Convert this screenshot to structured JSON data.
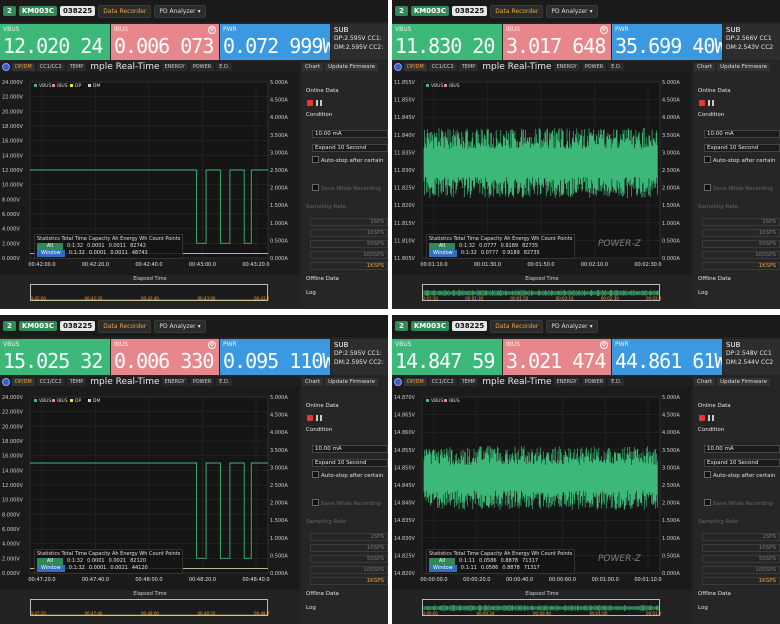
{
  "app": {
    "device_number": "2",
    "device_model": "KM003C",
    "device_serial": "038225",
    "data_recorder_label": "Data Recorder",
    "pd_analyzer_label": "PD Analyzer",
    "dropdown_caret": "▾"
  },
  "labels": {
    "vbus": "VBUS",
    "ibus": "IBUS",
    "pwr": "PWR",
    "sub": "SUB",
    "chart_title": "mple Real-Time",
    "stats_header": "Statistics  Total Time  Capacity Ah  Energy Wh  Count Points",
    "all": "All",
    "window": "Window",
    "elapsed_time": "Elapsed Time",
    "watermark": "POWER-Z"
  },
  "tabs": [
    "DP/DM",
    "CC1/CC2",
    "TEMP",
    "",
    "ENERGY",
    "POWER",
    "E.D."
  ],
  "side": {
    "tab_chart": "Chart",
    "tab_update": "Update Firmware",
    "online_data": "Online Data",
    "condition": "Condition",
    "cond_value": "10.00 mA",
    "expand": "Expand 10 Second",
    "autostop": "Auto-stop after certain",
    "save_recording": "Save While Recording",
    "sampling_rate": "Sampling Rate",
    "rates": [
      "1SPS",
      "10SPS",
      "50SPS",
      "100SPS",
      "1KSPS"
    ],
    "offline_data": "Offline Data",
    "log": "Log"
  },
  "colors": {
    "vbus": "#3cb878",
    "ibus": "#e8878b",
    "pwr": "#3a99e0",
    "accent": "#f2a23c",
    "dp": "#f0e040",
    "dm": "#cfcfcf"
  },
  "panels": [
    {
      "vbus": "12.020 24 V",
      "ibus": "0.006 073 A",
      "pwr": "0.072 999W",
      "sub_dp": "DP:2.595V",
      "sub_dm": "DM:2.595V",
      "sub_cc1": "CC1:",
      "sub_cc2": "CC2:",
      "legend": [
        "VBUS",
        "IBUS",
        "DP",
        "DM"
      ],
      "y_ticks": [
        "24.000V",
        "22.000V",
        "20.000V",
        "18.000V",
        "16.000V",
        "14.000V",
        "12.000V",
        "10.000V",
        "8.000V",
        "6.000V",
        "4.000V",
        "2.000V",
        "0.000V"
      ],
      "y2_ticks": [
        "5.000A",
        "4.500A",
        "4.000A",
        "3.500A",
        "3.000A",
        "2.500A",
        "2.000A",
        "1.500A",
        "1.000A",
        "0.500A",
        "0.000A"
      ],
      "x_ticks": [
        "00:42:00.0",
        "00:42:20.0",
        "00:42:40.0",
        "00:43:00.0",
        "00:43:20.0"
      ],
      "overview_ticks": [
        "00:42:00",
        "00:42:20",
        "00:42:40",
        "00:43:00",
        "00:43:20"
      ],
      "stats_all": [
        "0:1:32",
        "0.0001",
        "0.0011",
        "82742"
      ],
      "stats_window": [
        "0:1:32",
        "0.0001",
        "0.0011",
        "48743"
      ]
    },
    {
      "vbus": "11.830 20 V",
      "ibus": "3.017 648 A",
      "pwr": "35.699 40W",
      "sub_dp": "DP:2.566V",
      "sub_dm": "DM:2.543V",
      "sub_cc1": "CC1",
      "sub_cc2": "CC2",
      "legend": [
        "VBUS",
        "IBUS"
      ],
      "y_ticks": [
        "11.855V",
        "11.850V",
        "11.845V",
        "11.840V",
        "11.835V",
        "11.830V",
        "11.825V",
        "11.820V",
        "11.815V",
        "11.810V",
        "11.805V"
      ],
      "y2_ticks": [
        "5.000A",
        "4.500A",
        "4.000A",
        "3.500A",
        "3.000A",
        "2.500A",
        "2.000A",
        "1.500A",
        "1.000A",
        "0.500A",
        "0.000A"
      ],
      "x_ticks": [
        "00:01:10.0",
        "00:01:30.0",
        "00:01:50.0",
        "00:02:10.0",
        "00:02:30.0"
      ],
      "overview_ticks": [
        "00:01:10",
        "00:01:30",
        "00:01:50",
        "00:02:10",
        "00:02:30",
        "00:02:40"
      ],
      "stats_all": [
        "0:1:32",
        "0.0777",
        "0.9189",
        "82735"
      ],
      "stats_window": [
        "0:1:32",
        "0.0777",
        "0.9189",
        "82735"
      ]
    },
    {
      "vbus": "15.025 32 V",
      "ibus": "0.006 330 A",
      "pwr": "0.095 110W",
      "sub_dp": "DP:2.595V",
      "sub_dm": "DM:2.595V",
      "sub_cc1": "CC1:",
      "sub_cc2": "CC2:",
      "legend": [
        "VBUS",
        "IBUS",
        "DP",
        "DM"
      ],
      "y_ticks": [
        "24.000V",
        "22.000V",
        "20.000V",
        "18.000V",
        "16.000V",
        "14.000V",
        "12.000V",
        "10.000V",
        "8.000V",
        "6.000V",
        "4.000V",
        "2.000V",
        "0.000V"
      ],
      "y2_ticks": [
        "5.000A",
        "4.500A",
        "4.000A",
        "3.500A",
        "3.000A",
        "2.500A",
        "2.000A",
        "1.500A",
        "1.000A",
        "0.500A",
        "0.000A"
      ],
      "x_ticks": [
        "00:47:20.0",
        "00:47:40.0",
        "00:48:00.0",
        "00:48:20.0",
        "00:48:40.0"
      ],
      "overview_ticks": [
        "00:47:20",
        "00:47:40",
        "00:48:00",
        "00:48:20",
        "00:48:40"
      ],
      "stats_all": [
        "0:1:32",
        "0.0001",
        "0.0021",
        "82120"
      ],
      "stats_window": [
        "0:1:32",
        "0.0001",
        "0.0021",
        "44120"
      ]
    },
    {
      "vbus": "14.847 59 V",
      "ibus": "3.021 474 A",
      "pwr": "44.861 61W",
      "sub_dp": "DP:2.548V",
      "sub_dm": "DM:2.544V",
      "sub_cc1": "CC1",
      "sub_cc2": "CC2",
      "legend": [
        "VBUS",
        "IBUS"
      ],
      "y_ticks": [
        "14.870V",
        "14.865V",
        "14.860V",
        "14.855V",
        "14.850V",
        "14.845V",
        "14.840V",
        "14.835V",
        "14.830V",
        "14.825V",
        "14.820V"
      ],
      "y2_ticks": [
        "5.000A",
        "4.500A",
        "4.000A",
        "3.500A",
        "3.000A",
        "2.500A",
        "2.000A",
        "1.500A",
        "1.000A",
        "0.500A",
        "0.000A"
      ],
      "x_ticks": [
        "00:00:00.0",
        "00:00:20.0",
        "00:00:40.0",
        "00:00:60.0",
        "00:01:00.0",
        "00:01:10.0"
      ],
      "overview_ticks": [
        "00:00:00",
        "00:00:20",
        "00:00:40",
        "00:01:00",
        "00:01:10"
      ],
      "stats_all": [
        "0:1:11",
        "0.0586",
        "0.8878",
        "71317"
      ],
      "stats_window": [
        "0:1:11",
        "0.0586",
        "0.8878",
        "71317"
      ]
    }
  ],
  "chart_data": [
    {
      "type": "line",
      "x_range": [
        "00:42:00",
        "00:43:30"
      ],
      "ylim": [
        0,
        24
      ],
      "y2lim": [
        0,
        5
      ],
      "grid": true,
      "legend_position": "top-left",
      "series": [
        {
          "name": "VBUS",
          "x_frac": [
            0,
            0.7,
            0.7,
            0.74,
            0.74,
            0.8,
            0.8,
            0.84,
            0.84,
            0.9,
            0.9,
            0.93,
            0.93,
            1
          ],
          "values": [
            12,
            12,
            2,
            2,
            12,
            12,
            2,
            2,
            12,
            12,
            2,
            2,
            12,
            12
          ]
        },
        {
          "name": "DP",
          "x_frac": [
            0,
            1
          ],
          "values": [
            0.6,
            0.6
          ]
        },
        {
          "name": "DM",
          "x_frac": [
            0,
            1
          ],
          "values": [
            0.6,
            0.6
          ]
        }
      ]
    },
    {
      "type": "line",
      "ylim": [
        11.805,
        11.855
      ],
      "y2lim": [
        0,
        5
      ],
      "grid": true,
      "legend_position": "top-left",
      "series": [
        {
          "name": "VBUS",
          "band": [
            11.822,
            11.842
          ],
          "mean": 11.832
        }
      ]
    },
    {
      "type": "line",
      "ylim": [
        0,
        24
      ],
      "y2lim": [
        0,
        5
      ],
      "grid": true,
      "legend_position": "top-left",
      "series": [
        {
          "name": "VBUS",
          "x_frac": [
            0,
            0.7,
            0.7,
            0.74,
            0.74,
            0.8,
            0.8,
            0.84,
            0.84,
            0.9,
            0.9,
            0.93,
            0.93,
            1
          ],
          "values": [
            15,
            15,
            2,
            2,
            15,
            15,
            2,
            2,
            15,
            15,
            2,
            2,
            15,
            15
          ]
        },
        {
          "name": "DP",
          "x_frac": [
            0,
            1
          ],
          "values": [
            0.6,
            0.6
          ]
        },
        {
          "name": "DM",
          "x_frac": [
            0,
            1
          ],
          "values": [
            0.6,
            0.6
          ]
        }
      ]
    },
    {
      "type": "line",
      "ylim": [
        14.82,
        14.87
      ],
      "y2lim": [
        0,
        5
      ],
      "grid": true,
      "legend_position": "top-left",
      "series": [
        {
          "name": "VBUS",
          "band": [
            14.838,
            14.856
          ],
          "mean": 14.847
        }
      ]
    }
  ]
}
